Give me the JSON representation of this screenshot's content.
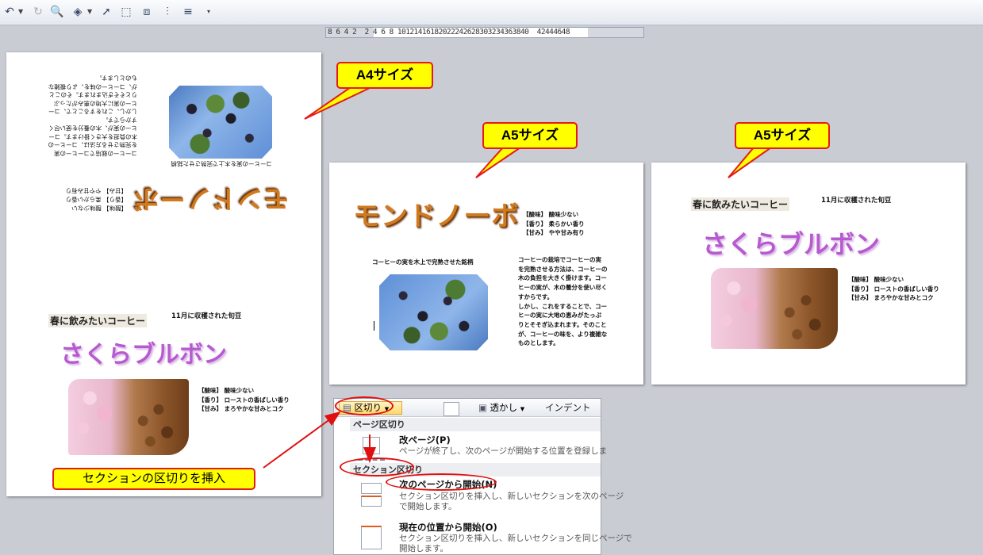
{
  "toolbar": {
    "buttons": [
      "undo-icon",
      "redo-icon",
      "print-preview-icon",
      "shapes-icon",
      "select-pointer-icon",
      "group-icon",
      "ungroup-icon",
      "align-icon",
      "distribute-icon",
      "customize-icon"
    ]
  },
  "ruler": {
    "text": "8 6 4 2  2 4 6 8 10121416182022242628303234363840  42444648"
  },
  "callouts": {
    "a4": "A4サイズ",
    "a5_left": "A5サイズ",
    "a5_right": "A5サイズ",
    "section_break": "セクションの区切りを挿入"
  },
  "page_a4": {
    "mirror_title": "モンドノーボ",
    "mirror_caption": "コーヒーの実を木上で完熟させた銘柄",
    "mirror_specs": [
      "【酸味】 酸味少ない",
      "【香り】 柔らかい香り",
      "【甘み】 やや甘み有り"
    ],
    "mirror_body": [
      "コーヒーの栽培でコーヒーの実",
      "を完熟させる方法は、コーヒーの",
      "木の負担を大きく掛けます。コー",
      "ヒーの実が、木の養分を使い尽く",
      "すからです。",
      "しかし、これをすることで、コー",
      "ヒーの実に大地の恵みがたっぷ",
      "りとそそぎ込まれます。そのこと",
      "が、コーヒーの味を、より複雑な",
      "ものとします。"
    ],
    "spring_label": "春に飲みたいコーヒー",
    "harvest_note": "11月に収穫された旬豆",
    "title": "さくらブルボン",
    "specs": [
      "【酸味】 酸味少ない",
      "【香り】 ローストの香ばしい香り",
      "【甘み】 まろやかな甘みとコク"
    ]
  },
  "page_a5_left": {
    "title": "モンドノーボ",
    "specs": [
      "【酸味】 酸味少ない",
      "【香り】 柔らかい香り",
      "【甘み】 やや甘み有り"
    ],
    "caption": "コーヒーの実を木上で完熟させた銘柄",
    "body": [
      "コーヒーの栽培でコーヒーの実",
      "を完熟させる方法は、コーヒーの",
      "木の負担を大きく掛けます。コー",
      "ヒーの実が、木の養分を使い尽く",
      "すからです。",
      "しかし、これをすることで、コー",
      "ヒーの実に大地の恵みがたっぷ",
      "りとそそぎ込まれます。そのこと",
      "が、コーヒーの味を、より複雑な",
      "ものとします。"
    ]
  },
  "page_a5_right": {
    "spring_label": "春に飲みたいコーヒー",
    "harvest_note": "11月に収穫された旬豆",
    "title": "さくらブルボン",
    "specs": [
      "【酸味】 酸味少ない",
      "【香り】 ローストの香ばしい香り",
      "【甘み】 まろやかな甘みとコク"
    ]
  },
  "menu": {
    "break_button": "区切り",
    "watermark": "透かし",
    "indent": "インデント",
    "page_breaks_header": "ページ区切り",
    "page_break_title": "改ページ(P)",
    "page_break_desc": "ページが終了し、次のページが開始する位置を登録しま",
    "section_breaks_header": "セクション区切り",
    "next_page_title": "次のページから開始(N)",
    "next_page_desc": [
      "セクション区切りを挿入し、新しいセクションを次のページ",
      "で開始します。"
    ],
    "continuous_title": "現在の位置から開始(O)",
    "continuous_desc": [
      "セクション区切りを挿入し、新しいセクションを同じページで",
      "開始します。"
    ]
  },
  "colors": {
    "callout_fill": "#ffff00",
    "callout_border": "#e31b1b",
    "annotation_red": "#e01010",
    "brown_title": "#d07a20",
    "purple_title": "#b75ad0"
  }
}
